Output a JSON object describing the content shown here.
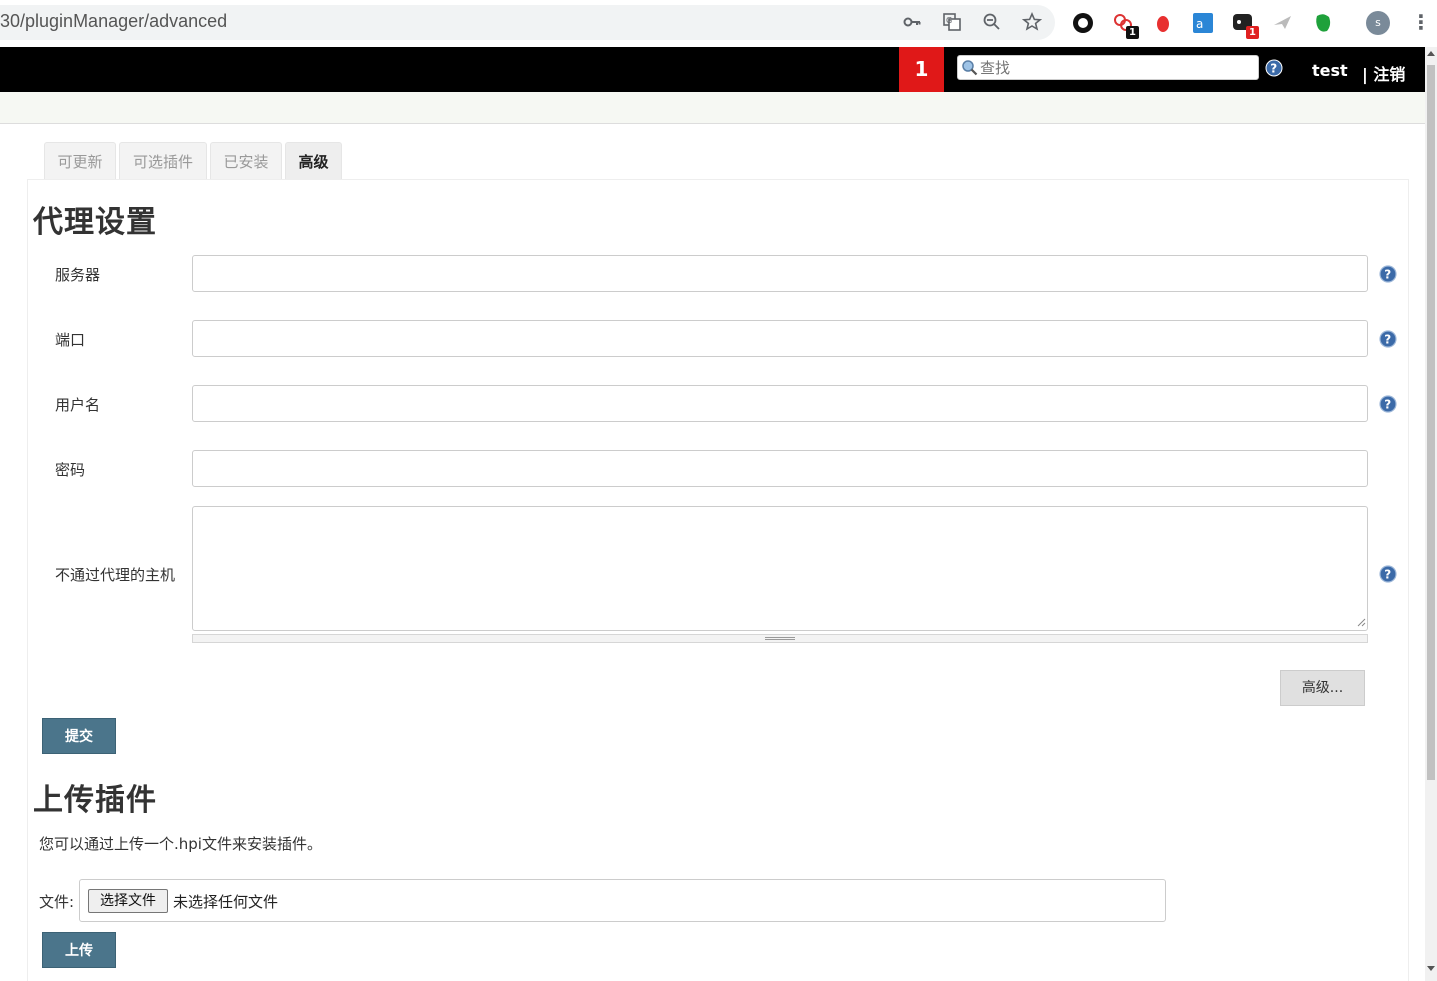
{
  "browser": {
    "url": "30/pluginManager/advanced",
    "extension_badges": [
      "1",
      "1"
    ],
    "avatar_letter": "s"
  },
  "header": {
    "notification_count": "1",
    "search_placeholder": "查找",
    "user": "test",
    "logout": "| 注销"
  },
  "tabs": [
    {
      "label": "可更新"
    },
    {
      "label": "可选插件"
    },
    {
      "label": "已安装"
    },
    {
      "label": "高级",
      "active": true
    }
  ],
  "proxy": {
    "title": "代理设置",
    "fields": {
      "server": {
        "label": "服务器",
        "value": ""
      },
      "port": {
        "label": "端口",
        "value": ""
      },
      "username": {
        "label": "用户名",
        "value": ""
      },
      "password": {
        "label": "密码",
        "value": ""
      },
      "no_proxy_host": {
        "label": "不通过代理的主机",
        "value": ""
      }
    },
    "advanced_button": "高级...",
    "submit_button": "提交"
  },
  "upload": {
    "title": "上传插件",
    "description": "您可以通过上传一个.hpi文件来安装插件。",
    "file_label": "文件:",
    "choose_file_button": "选择文件",
    "no_file_text": "未选择任何文件",
    "upload_button": "上传"
  },
  "colors": {
    "header_bg": "#000000",
    "notification_bg": "#e01818",
    "primary_button": "#4b758b",
    "help_icon": "#3b6aa8"
  }
}
